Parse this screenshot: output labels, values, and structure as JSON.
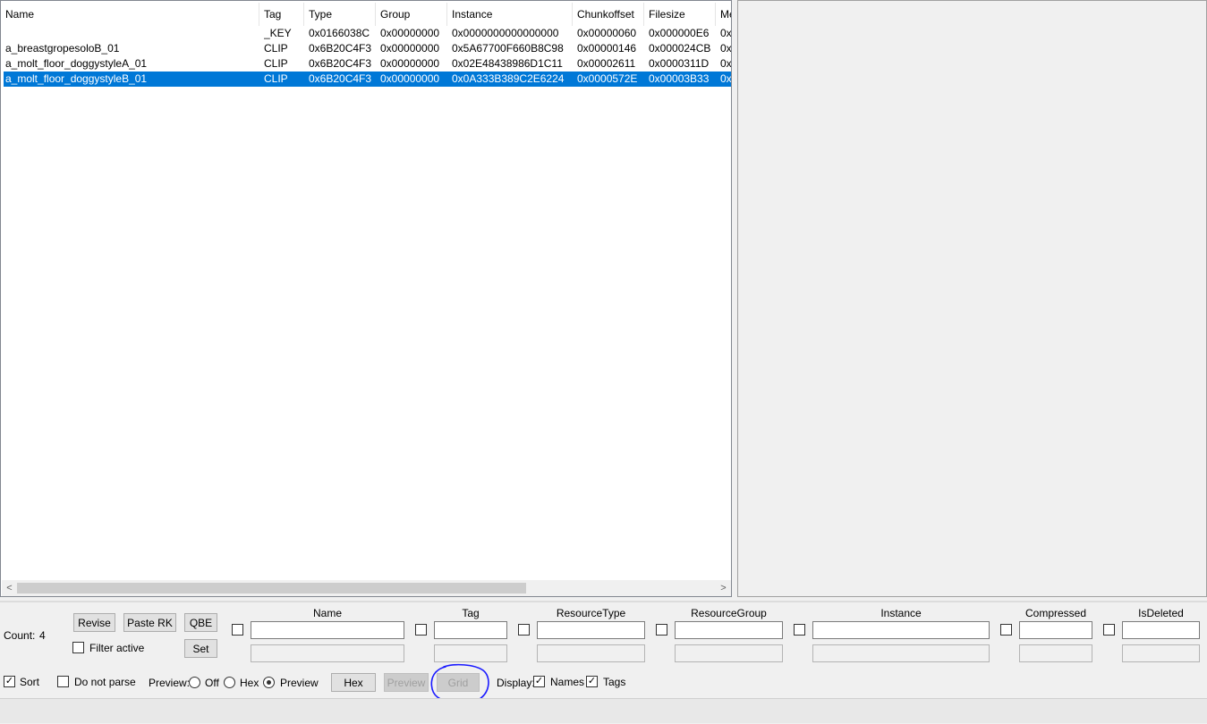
{
  "list": {
    "columns": [
      "Name",
      "Tag",
      "Type",
      "Group",
      "Instance",
      "Chunkoffset",
      "Filesize",
      "Me"
    ],
    "rows": [
      {
        "name": "",
        "tag": "_KEY",
        "type": "0x0166038C",
        "group": "0x00000000",
        "instance": "0x0000000000000000",
        "chunkoffset": "0x00000060",
        "filesize": "0x000000E6",
        "more": "0x",
        "selected": false
      },
      {
        "name": "a_breastgropesoloB_01",
        "tag": "CLIP",
        "type": "0x6B20C4F3",
        "group": "0x00000000",
        "instance": "0x5A67700F660B8C98",
        "chunkoffset": "0x00000146",
        "filesize": "0x000024CB",
        "more": "0x",
        "selected": false
      },
      {
        "name": "a_molt_floor_doggystyleA_01",
        "tag": "CLIP",
        "type": "0x6B20C4F3",
        "group": "0x00000000",
        "instance": "0x02E48438986D1C11",
        "chunkoffset": "0x00002611",
        "filesize": "0x0000311D",
        "more": "0x",
        "selected": false
      },
      {
        "name": "a_molt_floor_doggystyleB_01",
        "tag": "CLIP",
        "type": "0x6B20C4F3",
        "group": "0x00000000",
        "instance": "0x0A333B389C2E6224",
        "chunkoffset": "0x0000572E",
        "filesize": "0x00003B33",
        "more": "0x",
        "selected": true
      }
    ]
  },
  "scrollbar": {
    "left_arrow": "<",
    "right_arrow": ">"
  },
  "count": {
    "label": "Count:",
    "value": "4"
  },
  "buttons": {
    "revise": "Revise",
    "paste_rk": "Paste RK",
    "qbe": "QBE",
    "set": "Set",
    "hex": "Hex",
    "preview": "Preview",
    "grid": "Grid"
  },
  "filter_active": {
    "label": "Filter active",
    "checked": false
  },
  "filter_fields": [
    "Name",
    "Tag",
    "ResourceType",
    "ResourceGroup",
    "Instance",
    "Compressed",
    "IsDeleted"
  ],
  "sort": {
    "label": "Sort",
    "checked": true
  },
  "do_not_parse": {
    "label": "Do not parse",
    "checked": false
  },
  "preview_mode": {
    "label": "Preview:",
    "options": [
      "Off",
      "Hex",
      "Preview"
    ],
    "selected": "Preview"
  },
  "display": {
    "label": "Display:",
    "names": "Names",
    "tags": "Tags",
    "names_checked": true,
    "tags_checked": true
  },
  "colors": {
    "selection": "#0078d7",
    "annotation": "#1a1aff"
  }
}
